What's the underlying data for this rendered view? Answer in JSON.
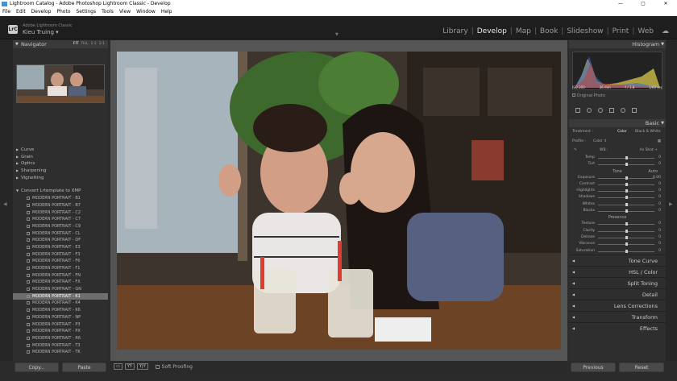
{
  "window": {
    "title": "Lightroom Catalog - Adobe Photoshop Lightroom Classic - Develop",
    "controls": [
      "—",
      "▢",
      "✕"
    ]
  },
  "menu": [
    "File",
    "Edit",
    "Develop",
    "Photo",
    "Settings",
    "Tools",
    "View",
    "Window",
    "Help"
  ],
  "identity": {
    "badge": "LrC",
    "app": "Adobe Lightroom Classic",
    "user": "Kieu Truing ▾"
  },
  "modules": [
    {
      "label": "Library",
      "active": false
    },
    {
      "label": "Develop",
      "active": true
    },
    {
      "label": "Map",
      "active": false
    },
    {
      "label": "Book",
      "active": false
    },
    {
      "label": "Slideshow",
      "active": false
    },
    {
      "label": "Print",
      "active": false
    },
    {
      "label": "Web",
      "active": false
    }
  ],
  "navigator": {
    "title": "Navigator",
    "zoom": [
      "FIT",
      "FILL",
      "1:1",
      "3:1"
    ]
  },
  "groups": [
    "Curve",
    "Grain",
    "Optics",
    "Sharpening",
    "Vignetting"
  ],
  "preset_folder": "Convert Lrtemplate to XMP",
  "presets": [
    "MODERN PORTRAIT - B1",
    "MODERN PORTRAIT - B7",
    "MODERN PORTRAIT - C2",
    "MODERN PORTRAIT - C7",
    "MODERN PORTRAIT - C9",
    "MODERN PORTRAIT - CL",
    "MODERN PORTRAIT - DF",
    "MODERN PORTRAIT - E3",
    "MODERN PORTRAIT - F3",
    "MODERN PORTRAIT - F6",
    "MODERN PORTRAIT - F1",
    "MODERN PORTRAIT - FN",
    "MODERN PORTRAIT - FX",
    "MODERN PORTRAIT - GN",
    "MODERN PORTRAIT - K1",
    "MODERN PORTRAIT - K4",
    "MODERN PORTRAIT - K6",
    "MODERN PORTRAIT - NP",
    "MODERN PORTRAIT - P3",
    "MODERN PORTRAIT - PX",
    "MODERN PORTRAIT - R6",
    "MODERN PORTRAIT - T3",
    "MODERN PORTRAIT - TK"
  ],
  "selected_preset": 14,
  "left_buttons": {
    "copy": "Copy...",
    "paste": "Paste"
  },
  "toolbar": {
    "soft_proofing": "Soft Proofing",
    "view1": "▭",
    "view2": "YY",
    "view3": "Y|Y"
  },
  "histogram": {
    "title": "Histogram",
    "iso": "ISO 200",
    "focal": "26 mm",
    "aperture": "f / 1.8",
    "shutter": "1/60 sec",
    "original": "Original Photo"
  },
  "basic": {
    "title": "Basic",
    "treatment_label": "Treatment :",
    "color": "Color",
    "bw": "Black & White",
    "profile_label": "Profile :",
    "profile_value": "Color ⇕",
    "wb_label": "WB :",
    "wb_value": "As Shot ÷",
    "tone_label": "Tone",
    "auto": "Auto",
    "presence_label": "Presence"
  },
  "sliders_wb": [
    {
      "label": "Temp",
      "value": "0",
      "pos": 0.5
    },
    {
      "label": "Tint",
      "value": "0",
      "pos": 0.5
    }
  ],
  "sliders_tone": [
    {
      "label": "Exposure",
      "value": "0.00",
      "pos": 0.5
    },
    {
      "label": "Contrast",
      "value": "0",
      "pos": 0.5
    },
    {
      "label": "Highlights",
      "value": "0",
      "pos": 0.5
    },
    {
      "label": "Shadows",
      "value": "0",
      "pos": 0.5
    },
    {
      "label": "Whites",
      "value": "0",
      "pos": 0.5
    },
    {
      "label": "Blacks",
      "value": "0",
      "pos": 0.5
    }
  ],
  "sliders_presence": [
    {
      "label": "Texture",
      "value": "0",
      "pos": 0.5
    },
    {
      "label": "Clarity",
      "value": "0",
      "pos": 0.5
    },
    {
      "label": "Dehaze",
      "value": "0",
      "pos": 0.5
    },
    {
      "label": "Vibrance",
      "value": "0",
      "pos": 0.5
    },
    {
      "label": "Saturation",
      "value": "0",
      "pos": 0.5
    }
  ],
  "panels": [
    "Tone Curve",
    "HSL / Color",
    "Split Toning",
    "Detail",
    "Lens Corrections",
    "Transform",
    "Effects"
  ],
  "right_buttons": {
    "previous": "Previous",
    "reset": "Reset"
  }
}
